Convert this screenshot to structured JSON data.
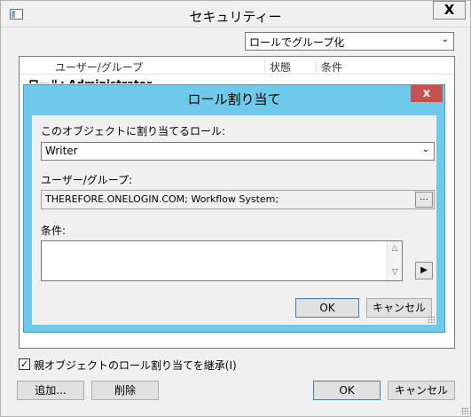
{
  "window": {
    "title": "セキュリティー",
    "close_label": "X"
  },
  "groupby": {
    "value": "ロールでグループ化"
  },
  "list": {
    "columns": [
      "ユーザー/グループ",
      "状態",
      "条件"
    ],
    "partial_row": "ロール: Administrator"
  },
  "dialog": {
    "title": "ロール割り当て",
    "close_label": "x",
    "role_label": "このオブジェクトに割り当てるロール:",
    "role_value": "Writer",
    "users_label": "ユーザー/グループ:",
    "users_value": "THEREFORE.ONELOGIN.COM; Workflow System;",
    "browse_label": "...",
    "condition_label": "条件:",
    "condition_value": "",
    "ok_label": "OK",
    "cancel_label": "キャンセル"
  },
  "footer": {
    "inherit_checked": true,
    "inherit_label": "親オブジェクトのロール割り当てを継承(I)",
    "add_label": "追加...",
    "delete_label": "削除",
    "ok_label": "OK",
    "cancel_label": "キャンセル"
  },
  "colors": {
    "dialog_frame": "#6ec9ea",
    "dialog_close": "#c75050",
    "window_bg": "#f0f0f0"
  }
}
